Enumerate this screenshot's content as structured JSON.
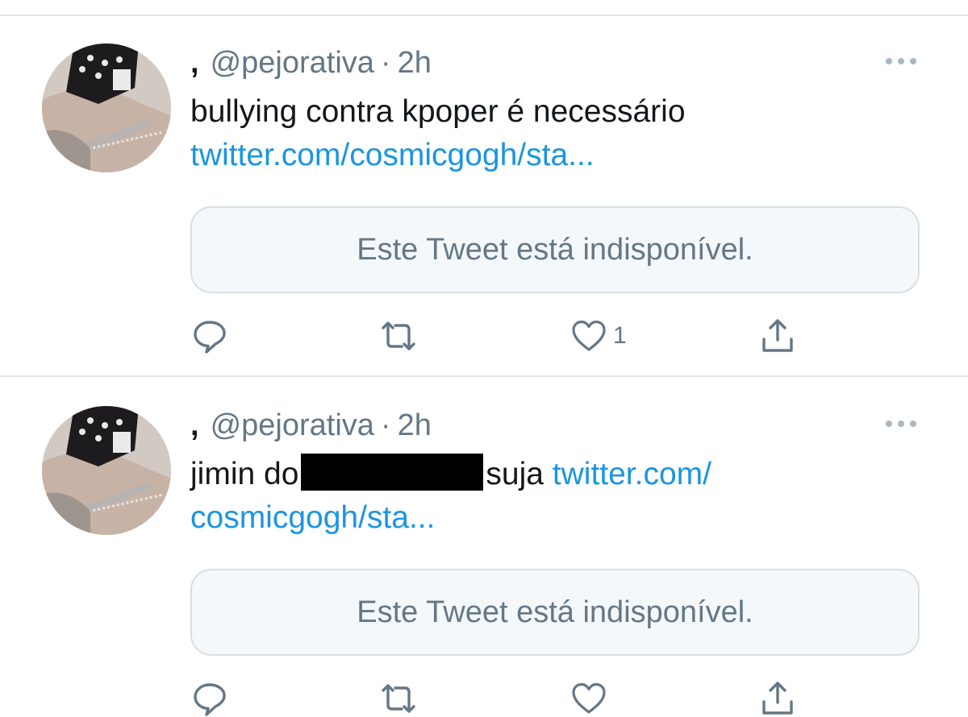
{
  "tweets": [
    {
      "display_name": ",",
      "handle": "@pejorativa",
      "separator": "·",
      "time": "2h",
      "text_before": "bullying contra kpoper é necessário",
      "redacted": false,
      "text_after": "",
      "link_line1": "twitter.com/cosmicgogh/sta...",
      "link_line2": "",
      "quote_text": "Este Tweet está indisponível.",
      "reply_count": "",
      "retweet_count": "",
      "like_count": "1"
    },
    {
      "display_name": ",",
      "handle": "@pejorativa",
      "separator": "·",
      "time": "2h",
      "text_before": "jimin do",
      "redacted": true,
      "text_after": "suja",
      "link_line1": "twitter.com/",
      "link_line2": "cosmicgogh/sta...",
      "quote_text": "Este Tweet está indisponível.",
      "reply_count": "",
      "retweet_count": "",
      "like_count": ""
    }
  ],
  "colors": {
    "link": "#1b95e0",
    "secondary_text": "#657786",
    "icon": "#657786",
    "divider": "#e1e8ed",
    "quote_bg": "#f5f8fa"
  },
  "icons": {
    "reply": "reply-icon",
    "retweet": "retweet-icon",
    "like": "heart-icon",
    "share": "share-icon",
    "more": "more-options-icon"
  }
}
